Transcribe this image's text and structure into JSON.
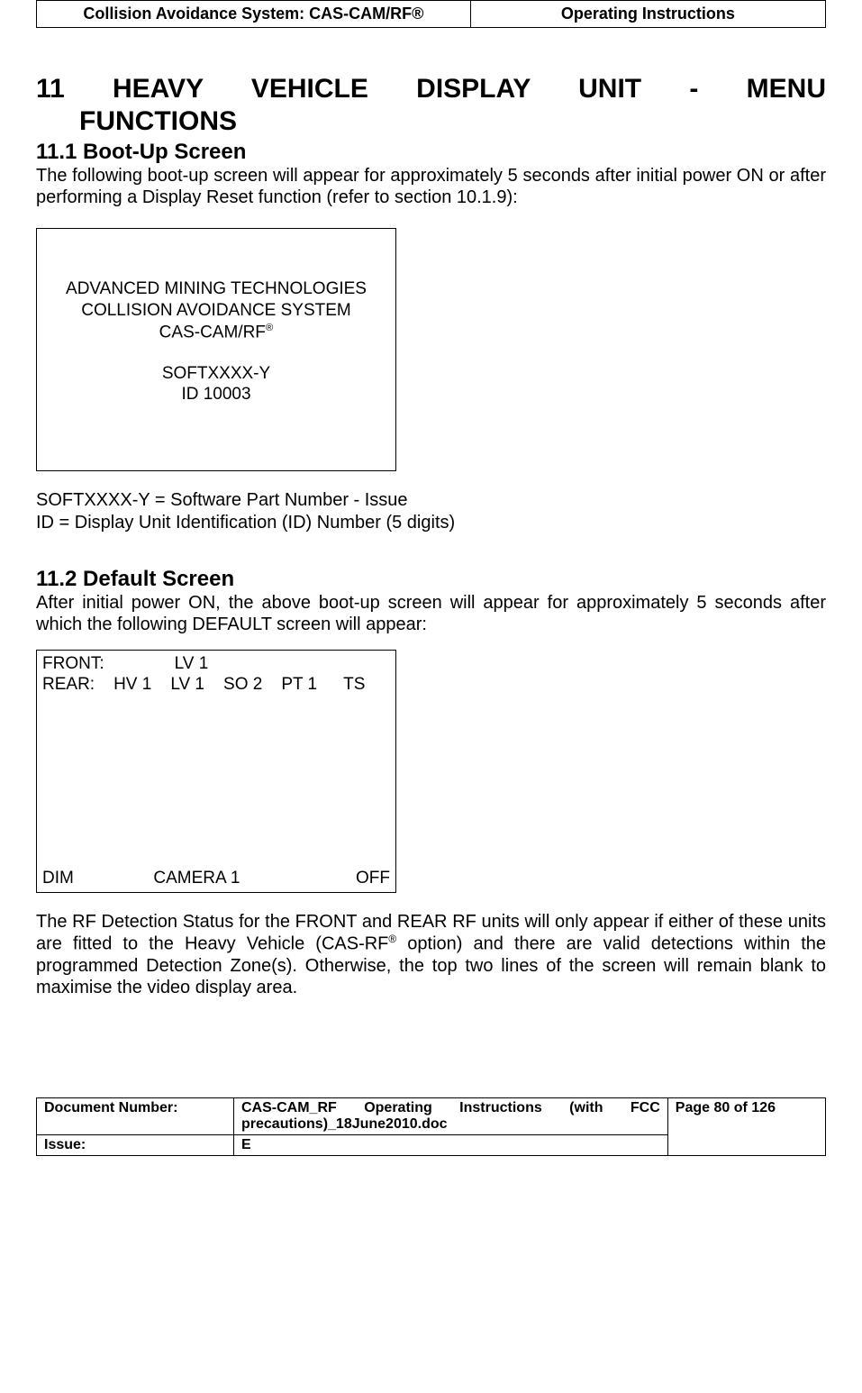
{
  "header": {
    "left": "Collision Avoidance System: CAS-CAM/RF®",
    "right": "Operating Instructions"
  },
  "section11": {
    "number": "11",
    "title_line1": "HEAVY   VEHICLE   DISPLAY   UNIT   -   MENU",
    "title_line2": "FUNCTIONS"
  },
  "section11_1": {
    "heading": "11.1 Boot-Up Screen",
    "intro": "The following boot-up screen will appear for approximately 5 seconds after initial power ON or after performing a Display Reset function (refer to section 10.1.9):",
    "bootup": {
      "line1": "ADVANCED MINING TECHNOLOGIES",
      "line2": "COLLISION AVOIDANCE SYSTEM",
      "line3_base": "CAS-CAM/RF",
      "line3_sup": "®",
      "line4": "SOFTXXXX-Y",
      "line5": "ID 10003"
    },
    "explain1": "SOFTXXXX-Y = Software Part Number - Issue",
    "explain2": "ID = Display Unit Identification (ID) Number (5 digits)"
  },
  "section11_2": {
    "heading": "11.2 Default Screen",
    "intro": "After initial power ON, the above boot-up screen will appear for approximately 5 seconds after which the following DEFAULT screen will appear:",
    "default_screen": {
      "front_label": "FRONT:",
      "front_vals": [
        "LV 1"
      ],
      "rear_label": "REAR:",
      "rear_vals": [
        "HV 1",
        "LV 1",
        "SO 2",
        "PT 1",
        "TS"
      ],
      "bottom_left": "DIM",
      "bottom_center": "CAMERA 1",
      "bottom_right": "OFF"
    },
    "para_after_prefix": "The RF Detection Status for the FRONT and REAR RF units will only appear if either of these units are fitted to the Heavy Vehicle (CAS-RF",
    "para_after_sup": "®",
    "para_after_suffix": " option) and there are valid detections within the programmed Detection Zone(s). Otherwise, the top two lines of the screen will remain blank to maximise the video display area."
  },
  "footer": {
    "doc_num_label": "Document Number:",
    "doc_num_line1": "CAS-CAM_RF Operating Instructions (with FCC",
    "doc_num_line2": "precautions)_18June2010.doc",
    "page_info": "Page 80 of  126",
    "issue_label": "Issue:",
    "issue_value": "E"
  }
}
